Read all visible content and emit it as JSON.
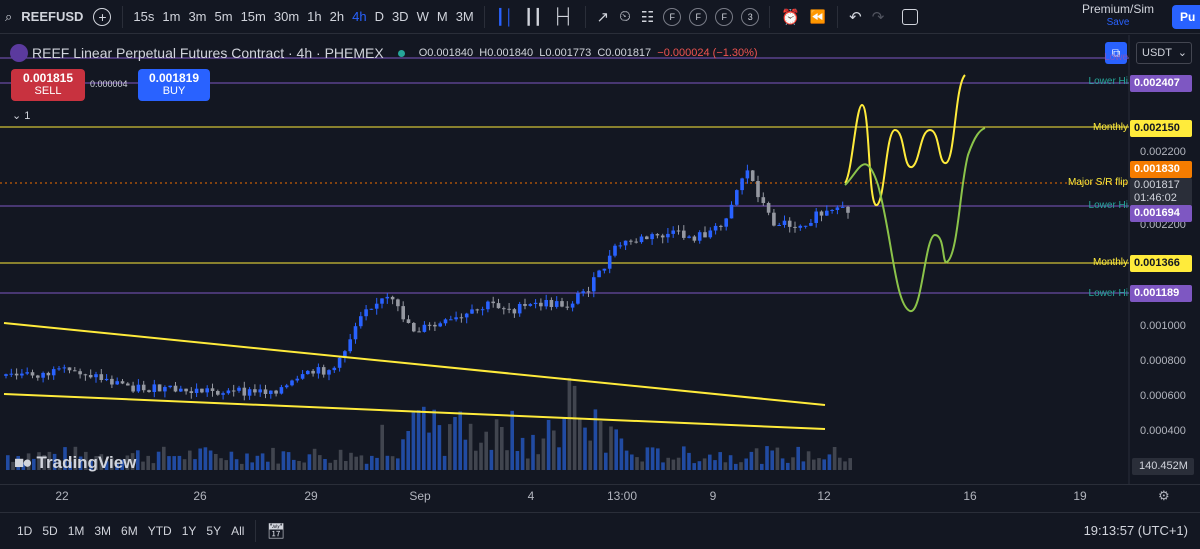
{
  "toolbar": {
    "symbol": "REEFUSD",
    "timeframes": [
      "15s",
      "1m",
      "3m",
      "5m",
      "15m",
      "30m",
      "1h",
      "2h",
      "4h",
      "D",
      "3D",
      "W",
      "M",
      "3M"
    ],
    "active_timeframe": "4h",
    "flag_buttons": [
      "F",
      "F",
      "F",
      "3"
    ],
    "account_name": "Premium/Sim",
    "save_label": "Save",
    "publish_label": "Pu"
  },
  "legend": {
    "title": "REEF Linear Perpetual Futures Contract · 4h · PHEMEX",
    "open": "O0.001840",
    "high": "H0.001840",
    "low": "L0.001773",
    "close": "C0.001817",
    "change": "−0.000024 (−1.30%)"
  },
  "trade": {
    "sell_price": "0.001815",
    "sell_label": "SELL",
    "buy_price": "0.001819",
    "buy_label": "BUY",
    "spread": "0.000004",
    "indicator_count": "1"
  },
  "currency": "USDT",
  "levels": {
    "lower_hi_cut": "Lowe",
    "lower_hi_top_label": "Lower Hi",
    "lower_hi_top_price": "0.002407",
    "monthly_top_label": "Monthly",
    "monthly_top_price": "0.002150",
    "major_label": "Major S/R flip",
    "current_price": "0.001830",
    "last_price": "0.001817",
    "countdown": "01:46:02",
    "lower_hi_mid_label": "Lower Hi",
    "lower_hi_mid_price": "0.001694",
    "monthly_low_label": "Monthly",
    "monthly_low_price": "0.001366",
    "lower_hi_low_label": "Lower Hi",
    "lower_hi_low_price": "0.001189"
  },
  "price_axis": [
    "0.002200",
    "0.002000",
    "0.001000",
    "0.000800",
    "0.000600",
    "0.000400"
  ],
  "volume": "140.452M",
  "brand": "TradingView",
  "time_axis": [
    "22",
    "26",
    "29",
    "Sep",
    "4",
    "13:00",
    "9",
    "12",
    "16",
    "19"
  ],
  "range_buttons": [
    "1D",
    "5D",
    "1M",
    "3M",
    "6M",
    "YTD",
    "1Y",
    "5Y",
    "All"
  ],
  "clock": "19:13:57 (UTC+1)",
  "colors": {
    "background": "#131722",
    "up": "#2962ff",
    "down": "#787b86",
    "monthly": "#ffeb3b",
    "lower_hi": "#7e57c2",
    "projection_green": "#8bc34a"
  },
  "chart_data": {
    "type": "candlestick",
    "symbol": "REEFUSD",
    "interval": "4h",
    "horizontal_levels": [
      {
        "name": "Lower Hi",
        "price": 0.002407
      },
      {
        "name": "Monthly",
        "price": 0.00215
      },
      {
        "name": "Major S/R flip",
        "price": 0.00183
      },
      {
        "name": "Lower Hi",
        "price": 0.001694
      },
      {
        "name": "Monthly",
        "price": 0.001366
      },
      {
        "name": "Lower Hi",
        "price": 0.001189
      }
    ],
    "closes": [
      0.00075,
      0.00076,
      0.00077,
      0.00078,
      0.00072,
      0.00068,
      0.00066,
      0.00065,
      0.00066,
      0.00064,
      0.00065,
      0.00068,
      0.00077,
      0.00081,
      0.0012,
      0.00125,
      0.00105,
      0.00108,
      0.00113,
      0.00122,
      0.00118,
      0.00122,
      0.00121,
      0.00135,
      0.0016,
      0.00164,
      0.00167,
      0.00165,
      0.00171,
      0.0021,
      0.00175,
      0.00173,
      0.0018,
      0.001817
    ],
    "ylim": [
      0.0003,
      0.0026
    ]
  }
}
